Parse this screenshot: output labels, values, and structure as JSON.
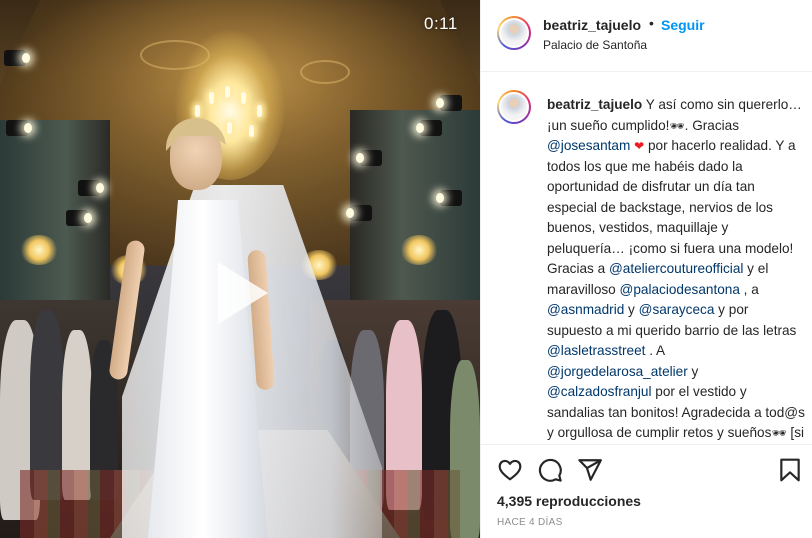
{
  "video": {
    "timestamp": "0:11",
    "play_icon": "play-icon"
  },
  "header": {
    "username": "beatriz_tajuelo",
    "separator": "•",
    "follow_label": "Seguir",
    "location": "Palacio de Santoña"
  },
  "caption": {
    "username": "beatriz_tajuelo",
    "segments": [
      {
        "t": "Y así como sin quererlo… ¡un sueño cumplido!"
      },
      {
        "e": "🕶",
        "cls": "emoji"
      },
      {
        "t": ". Gracias "
      },
      {
        "m": "@josesantam"
      },
      {
        "t": " "
      },
      {
        "e": "❤",
        "cls": "emoji heart"
      },
      {
        "t": "  por hacerlo realidad. Y a todos los que me habéis dado la oportunidad de disfrutar un día tan especial de backstage, nervios de los buenos, vestidos, maquillaje y peluquería… ¡como si fuera una modelo! Gracias a "
      },
      {
        "m": "@ateliercoutureofficial"
      },
      {
        "t": " y el maravilloso "
      },
      {
        "m": "@palaciodesantona"
      },
      {
        "t": " , a "
      },
      {
        "m": "@asnmadrid"
      },
      {
        "t": " y "
      },
      {
        "m": "@sarayceca"
      },
      {
        "t": " y por supuesto a mi querido barrio de las letras "
      },
      {
        "m": "@lasletrasstreet"
      },
      {
        "t": " . A "
      },
      {
        "m": "@jorgedelarosa_atelier"
      },
      {
        "t": " y "
      },
      {
        "m": "@calzadosfranjul"
      },
      {
        "t": " por el vestido y sandalias tan bonitos! Agradecida a tod@s y orgullosa de cumplir retos y sueños"
      },
      {
        "e": "🕶",
        "cls": "emoji"
      },
      {
        "t": "  [si los deseas con fuerza y los enfocas se cumplen, recuerda] "
      },
      {
        "e": "☺",
        "cls": "emoji sun"
      },
      {
        "e": "☺",
        "cls": "emoji sun"
      }
    ]
  },
  "actions": {
    "like_icon": "heart-icon",
    "comment_icon": "comment-icon",
    "share_icon": "send-icon",
    "save_icon": "bookmark-icon",
    "views": "4,395 reproducciones",
    "time_ago": "HACE 4 DÍAS"
  },
  "colors": {
    "link": "#0095f6",
    "mention": "#00376b",
    "text": "#262626",
    "muted": "#8e8e8e",
    "border": "#efefef"
  }
}
